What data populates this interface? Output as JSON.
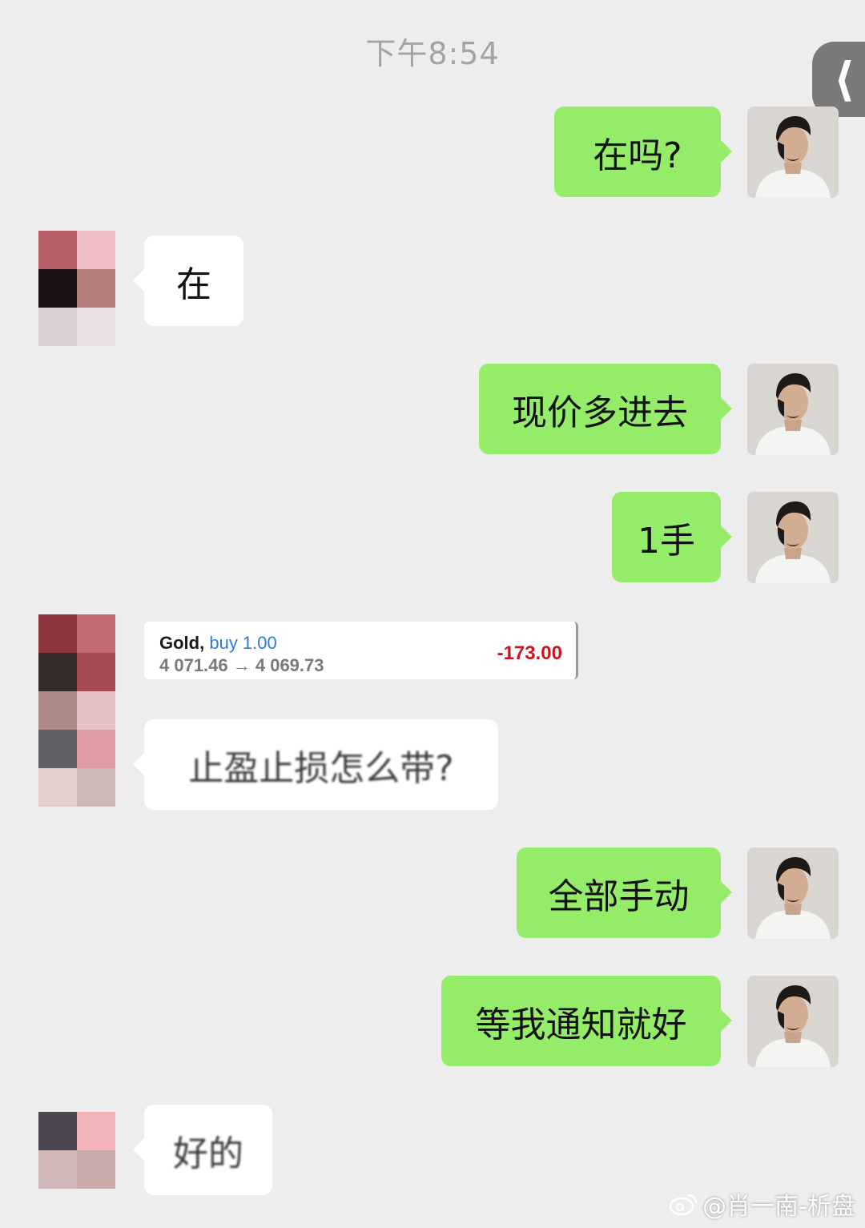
{
  "timestamp": "下午8:54",
  "back_icon": "chevron-left-icon",
  "messages": [
    {
      "side": "out",
      "text": "在吗?"
    },
    {
      "side": "in",
      "text": "在"
    },
    {
      "side": "out",
      "text": "现价多进去"
    },
    {
      "side": "out",
      "text": "1手"
    },
    {
      "side": "in",
      "type": "trade_card"
    },
    {
      "side": "in",
      "text": "止盈止损怎么带?"
    },
    {
      "side": "out",
      "text": "全部手动"
    },
    {
      "side": "out",
      "text": "等我通知就好"
    },
    {
      "side": "in",
      "text": "好的"
    }
  ],
  "trade": {
    "symbol": "Gold,",
    "direction": "buy 1.00",
    "prices": "4 071.46 → 4 069.73",
    "pl": "-173.00"
  },
  "watermark": "@肖一南-析盘",
  "colors": {
    "background": "#ededed",
    "outgoing_bubble": "#95ec69",
    "incoming_bubble": "#ffffff",
    "profit_negative": "#c9161d",
    "direction_blue": "#2c7bd8"
  }
}
